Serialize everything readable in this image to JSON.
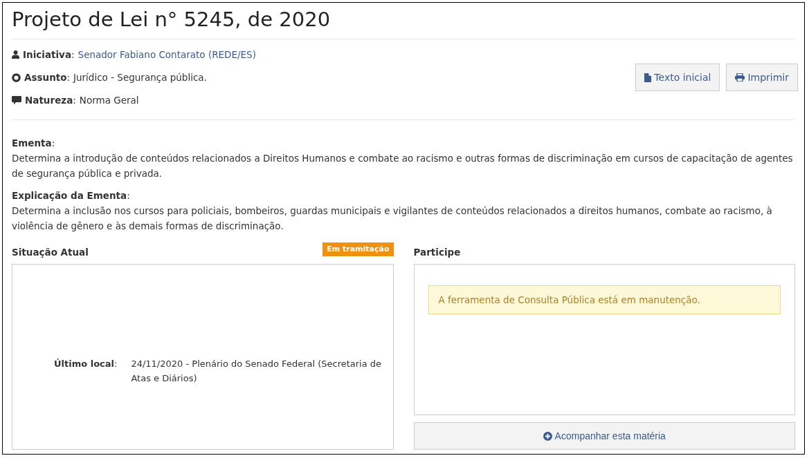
{
  "title": "Projeto de Lei n° 5245, de 2020",
  "meta": [
    {
      "kind": "user",
      "label": "**Iniciativa**:",
      "value": "Senador Fabiano Contarato (REDE/ES)",
      "link": true
    },
    {
      "kind": "circle",
      "label": "**Assunto**:",
      "value": "Jurídico - Segurança pública.",
      "link": false
    },
    {
      "kind": "comment",
      "label": "**Natureza**:",
      "value": "Norma Geral",
      "link": false
    }
  ],
  "actions": [
    {
      "kind": "file",
      "label": "Texto inicial"
    },
    {
      "kind": "print",
      "label": "Imprimir"
    }
  ],
  "sections": [
    {
      "heading": "**Ementa**:",
      "text": "Determina a introdução de conteúdos relacionados a Direitos Humanos e combate ao racismo e outras formas de discriminação em cursos de capacitação de agentes de segurança pública e privada."
    },
    {
      "heading": "**Explicação da Ementa**:",
      "text": "Determina a inclusão nos cursos para policiais, bombeiros, guardas municipais e vigilantes de conteúdos relacionados a direitos humanos, combate ao racismo, à violência de gênero e às demais formas de discriminação."
    }
  ],
  "situacao": {
    "heading": "Situação Atual",
    "badge": "Em tramitação",
    "label": "**Último local**:",
    "value": "24/11/2020 - Plenário do Senado Federal (Secretaria de Atas e Diários)"
  },
  "participe": {
    "heading": "Participe",
    "alert": "A ferramenta de Consulta Pública está em manutenção.",
    "button": "Acompanhar esta matéria"
  }
}
